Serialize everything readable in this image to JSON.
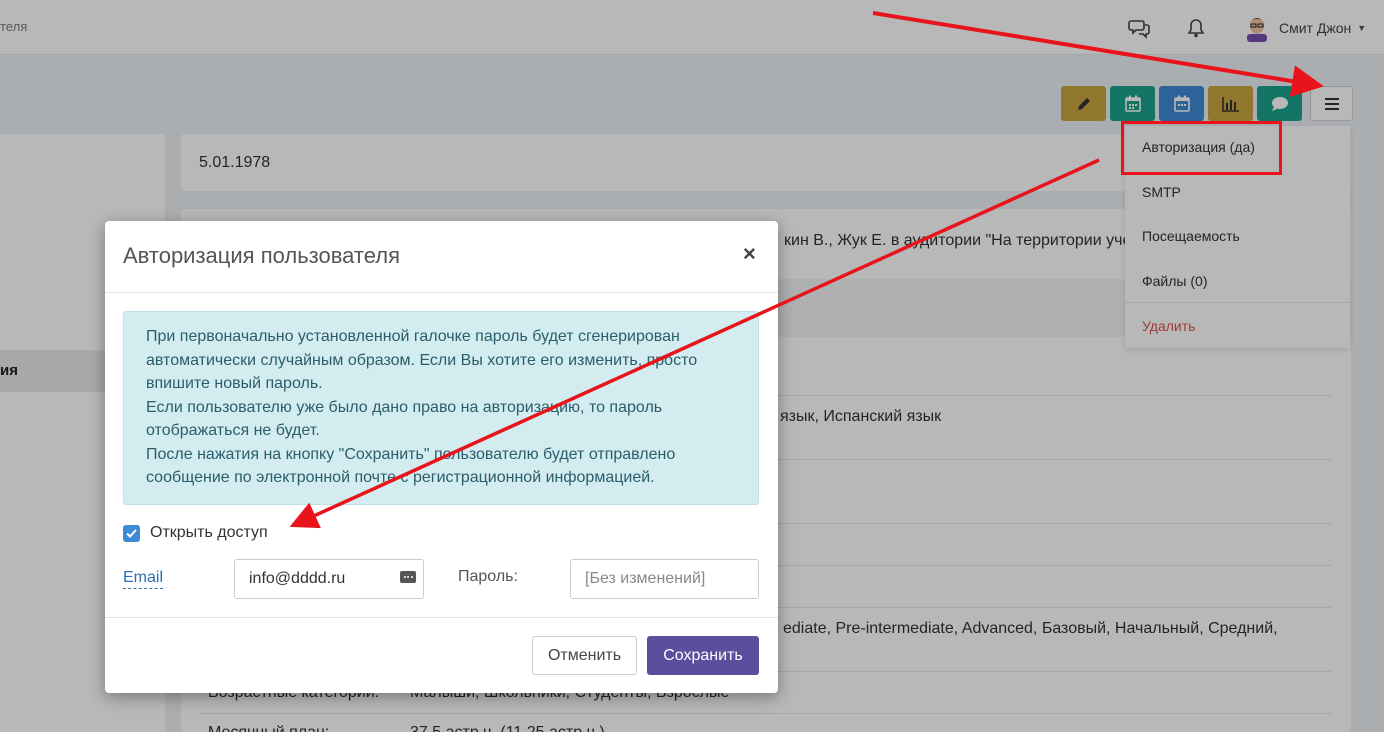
{
  "topbar": {
    "breadcrumb_tail": "теля",
    "user_name": "Смит Джон",
    "icons": [
      "chat-icon",
      "bell-icon"
    ]
  },
  "page": {
    "birthdate": "5.01.1978",
    "description_fragment": "кин В., Жук Е. в аудитории \"На территории уче",
    "left_active_item": "ия",
    "languages_fragment": "язык, Испанский язык",
    "levels_fragment": "ediate, Pre-intermediate, Advanced, Базовый, Начальный, Средний,",
    "age_label": "Возрастные категории:",
    "age_value": "Малыши, Школьники, Студенты, Взрослые",
    "plan_label": "Месячный план:",
    "plan_value": "37,5 астр.ч. (11,25 астр.ч.)"
  },
  "toolbar": {
    "buttons": [
      {
        "name": "edit",
        "icon": "pencil-icon",
        "color": "#c9a640"
      },
      {
        "name": "calendar-1",
        "icon": "calendar-icon",
        "color": "#1aa28c"
      },
      {
        "name": "calendar-2",
        "icon": "calendar-icon",
        "color": "#3d8bd4"
      },
      {
        "name": "stats",
        "icon": "bar-chart-icon",
        "color": "#c9a640"
      },
      {
        "name": "comment",
        "icon": "comment-icon",
        "color": "#1aa28c"
      },
      {
        "name": "menu",
        "icon": "hamburger-icon",
        "color": "#ffffff"
      }
    ]
  },
  "dropdown": {
    "items": [
      "Авторизация (да)",
      "SMTP",
      "Посещаемость",
      "Файлы (0)"
    ],
    "delete_label": "Удалить"
  },
  "modal": {
    "title": "Авторизация пользователя",
    "close_glyph": "×",
    "alert_lines": [
      "При первоначально установленной галочке пароль будет сгенерирован автоматически случайным образом. Если Вы хотите его изменить, просто впишите новый пароль.",
      "Если пользователю уже было дано право на авторизацию, то пароль отображаться не будет.",
      "После нажатия на кнопку \"Сохранить\" пользователю будет отправлено сообщение по электронной почте с регистрационной информацией."
    ],
    "checkbox_label": "Открыть доступ",
    "checkbox_checked": true,
    "email_label": "Email",
    "email_value": "info@dddd.ru",
    "password_label": "Пароль:",
    "password_placeholder": "[Без изменений]",
    "cancel_label": "Отменить",
    "save_label": "Сохранить"
  },
  "colors": {
    "accent": "#5a4e9e",
    "link": "#2a6fb0",
    "alert_bg": "#d3ecf0",
    "annotation": "#e8131b",
    "delete": "#d9534f"
  }
}
